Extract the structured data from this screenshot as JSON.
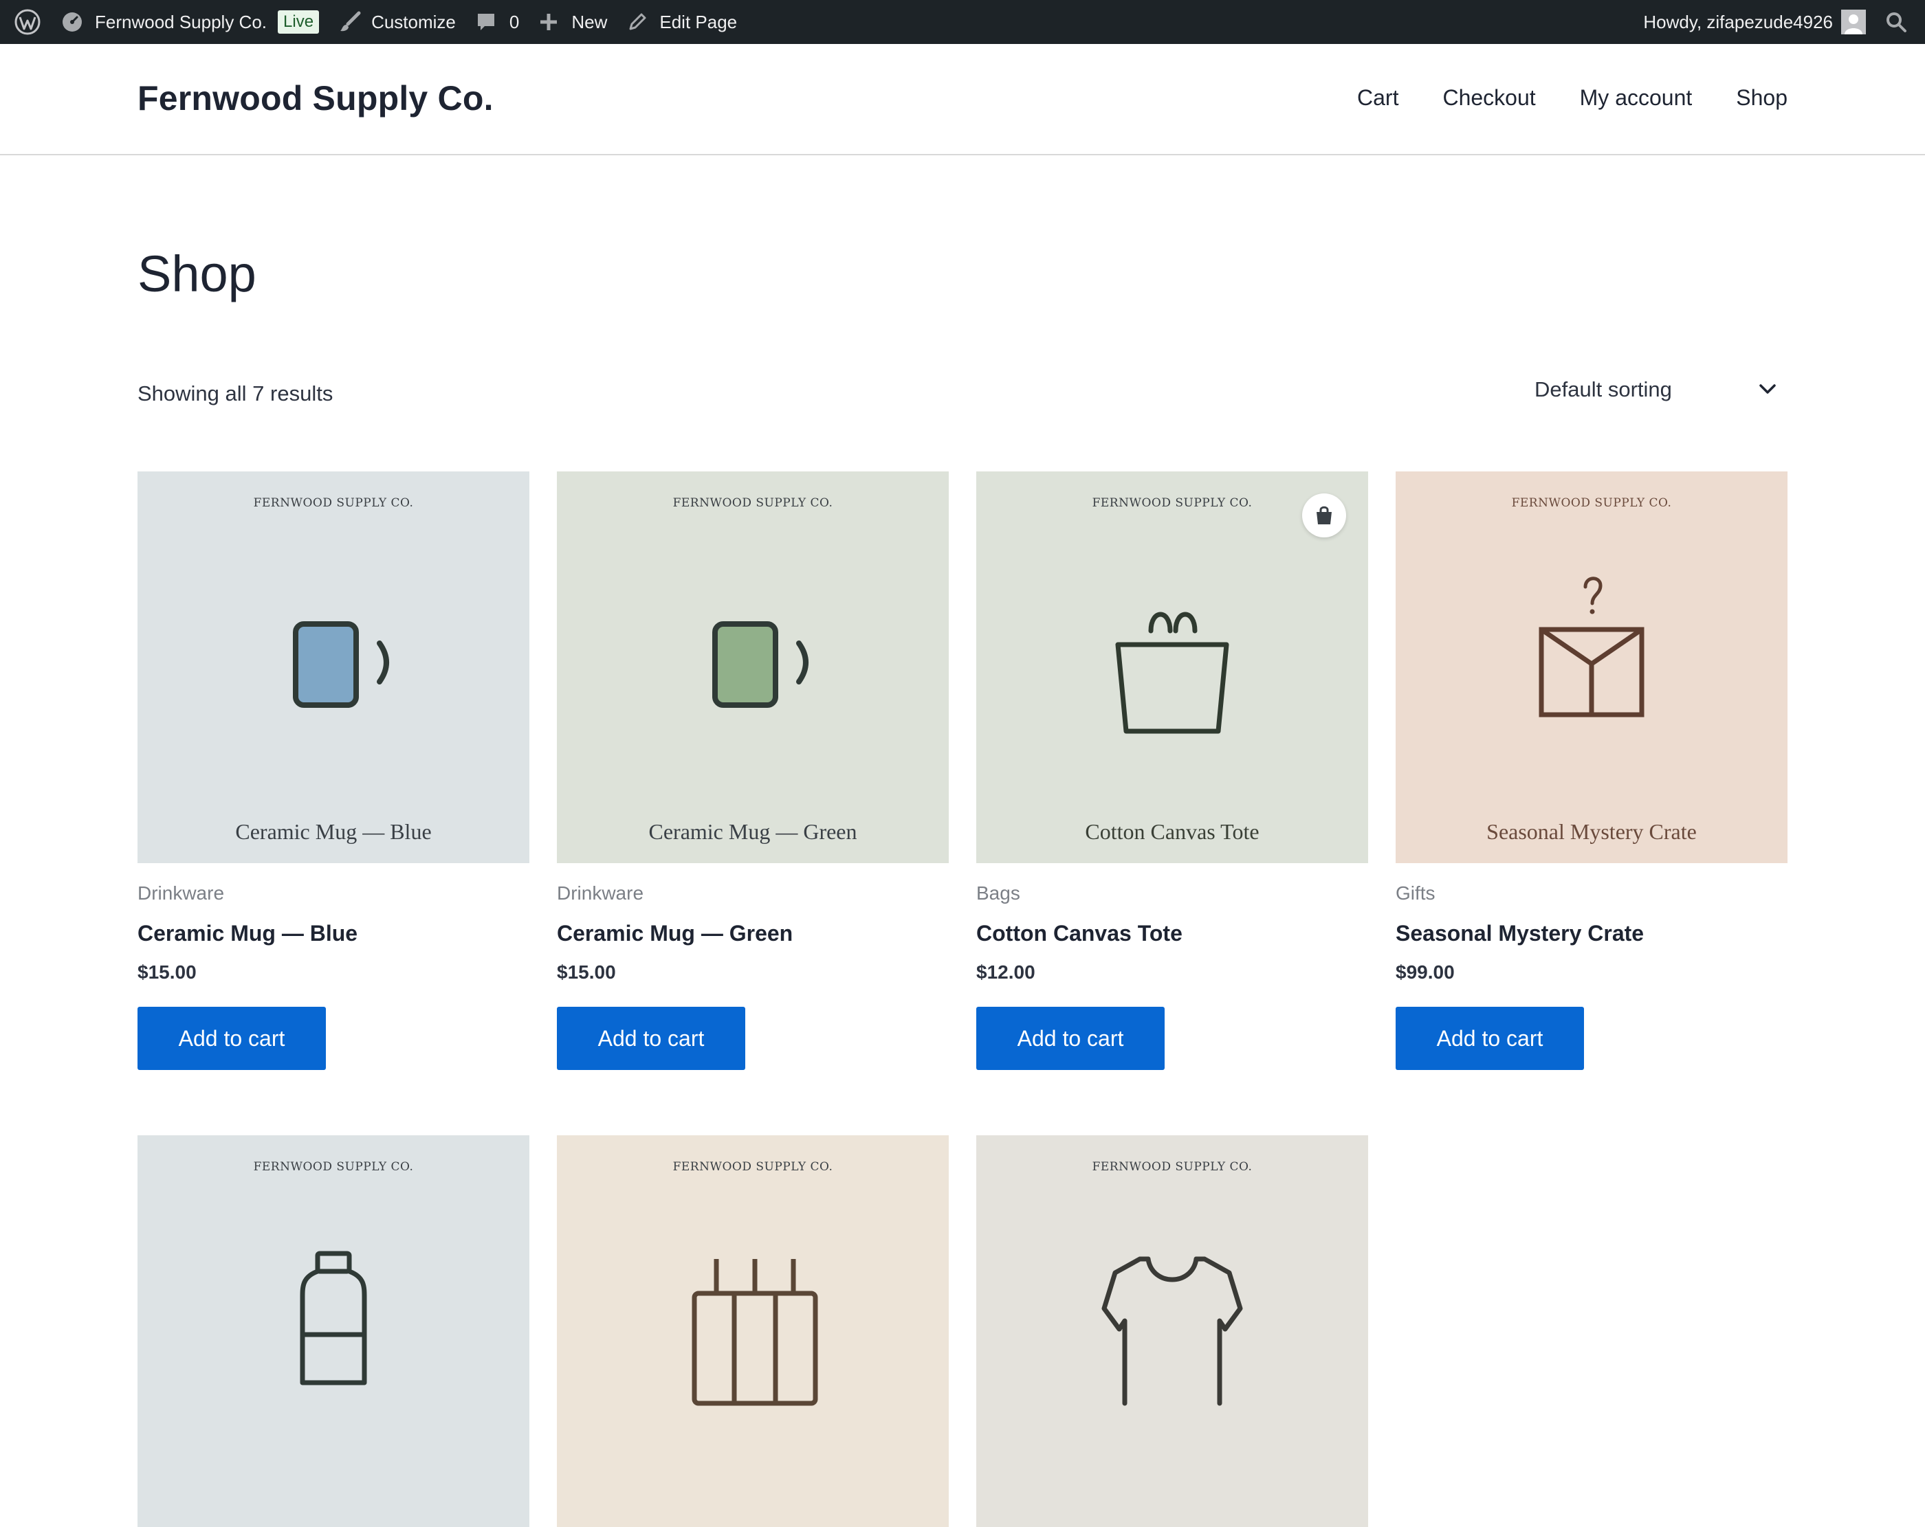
{
  "admin_bar": {
    "site_name": "Fernwood Supply Co.",
    "live_badge": "Live",
    "customize": "Customize",
    "comments_count": "0",
    "new_label": "New",
    "edit_page": "Edit Page",
    "greeting": "Howdy, zifapezude4926"
  },
  "header": {
    "site_title": "Fernwood Supply Co.",
    "nav": [
      "Cart",
      "Checkout",
      "My account",
      "Shop"
    ]
  },
  "page": {
    "title": "Shop",
    "result_count": "Showing all 7 results",
    "sorting": "Default sorting"
  },
  "products": [
    {
      "brand": "FERNWOOD SUPPLY CO.",
      "caption": "Ceramic Mug — Blue",
      "category": "Drinkware",
      "name": "Ceramic Mug — Blue",
      "price": "$15.00",
      "button": "Add to cart",
      "bg": "#dde3e5",
      "icon": "mug-icon",
      "accent": "#7fa7c6"
    },
    {
      "brand": "FERNWOOD SUPPLY CO.",
      "caption": "Ceramic Mug — Green",
      "category": "Drinkware",
      "name": "Ceramic Mug — Green",
      "price": "$15.00",
      "button": "Add to cart",
      "bg": "#dde2d9",
      "icon": "mug-icon",
      "accent": "#91b08a"
    },
    {
      "brand": "FERNWOOD SUPPLY CO.",
      "caption": "Cotton Canvas Tote",
      "category": "Bags",
      "name": "Cotton Canvas Tote",
      "price": "$12.00",
      "button": "Add to cart",
      "bg": "#dde2d9",
      "icon": "tote-bag-icon",
      "badge_icon": "shopping-bag-icon"
    },
    {
      "brand": "FERNWOOD SUPPLY CO.",
      "caption": "Seasonal Mystery Crate",
      "category": "Gifts",
      "name": "Seasonal Mystery Crate",
      "price": "$99.00",
      "button": "Add to cart",
      "bg": "#eddcd0",
      "icon": "mystery-box-icon"
    },
    {
      "brand": "FERNWOOD SUPPLY CO.",
      "bg": "#dde3e5",
      "icon": "bottle-icon"
    },
    {
      "brand": "FERNWOOD SUPPLY CO.",
      "bg": "#ede4d8",
      "icon": "crate-icon"
    },
    {
      "brand": "FERNWOOD SUPPLY CO.",
      "bg": "#e4e2dc",
      "icon": "tshirt-icon"
    }
  ]
}
